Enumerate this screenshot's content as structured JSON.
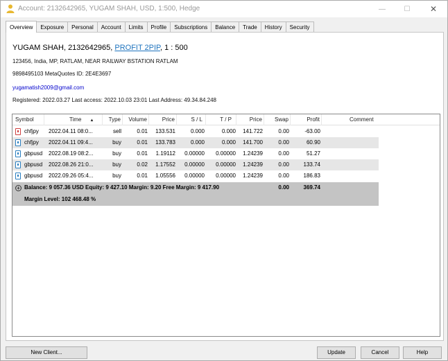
{
  "window": {
    "title": "Account: 2132642965, YUGAM SHAH, USD, 1:500, Hedge"
  },
  "tabs": [
    {
      "label": "Overview",
      "active": true
    },
    {
      "label": "Exposure"
    },
    {
      "label": "Personal"
    },
    {
      "label": "Account"
    },
    {
      "label": "Limits"
    },
    {
      "label": "Profile"
    },
    {
      "label": "Subscriptions"
    },
    {
      "label": "Balance"
    },
    {
      "label": "Trade"
    },
    {
      "label": "History"
    },
    {
      "label": "Security"
    }
  ],
  "overview": {
    "name_prefix": "YUGAM SHAH, 2132642965, ",
    "group_link": "PROFIT 2PIP",
    "leverage": ", 1 : 500",
    "address": "123456, India, MP, RATLAM, NEAR RAILWAY BSTATION RATLAM",
    "phone_line": "9898495103  MetaQuotes ID: 2E4E3697",
    "email": "yugamatish2009@gmail.com",
    "registered_line": "Registered: 2022.03.27  Last access: 2022.10.03 23:01  Last Address: 49.34.84.248"
  },
  "table": {
    "headers": {
      "symbol": "Symbol",
      "time": "Time",
      "type": "Type",
      "volume": "Volume",
      "price": "Price",
      "sl": "S / L",
      "tp": "T / P",
      "price2": "Price",
      "swap": "Swap",
      "profit": "Profit",
      "comment": "Comment"
    },
    "sort_indicator": "▲",
    "rows": [
      {
        "symbol": "chfjpy",
        "time": "2022.04.11 08:0...",
        "type": "sell",
        "volume": "0.01",
        "price": "133.531",
        "sl": "0.000",
        "tp": "0.000",
        "price2": "141.722",
        "swap": "0.00",
        "profit": "-63.00",
        "comment": "",
        "icon": "sell-order-icon"
      },
      {
        "symbol": "chfjpy",
        "time": "2022.04.11 09:4...",
        "type": "buy",
        "volume": "0.01",
        "price": "133.783",
        "sl": "0.000",
        "tp": "0.000",
        "price2": "141.700",
        "swap": "0.00",
        "profit": "60.90",
        "comment": "",
        "icon": "buy-order-icon"
      },
      {
        "symbol": "gbpusd",
        "time": "2022.08.19 08:2...",
        "type": "buy",
        "volume": "0.01",
        "price": "1.19112",
        "sl": "0.00000",
        "tp": "0.00000",
        "price2": "1.24239",
        "swap": "0.00",
        "profit": "51.27",
        "comment": "",
        "icon": "buy-order-icon"
      },
      {
        "symbol": "gbpusd",
        "time": "2022.08.26 21:0...",
        "type": "buy",
        "volume": "0.02",
        "price": "1.17552",
        "sl": "0.00000",
        "tp": "0.00000",
        "price2": "1.24239",
        "swap": "0.00",
        "profit": "133.74",
        "comment": "",
        "icon": "buy-order-icon"
      },
      {
        "symbol": "gbpusd",
        "time": "2022.09.26 05:4...",
        "type": "buy",
        "volume": "0.01",
        "price": "1.05556",
        "sl": "0.00000",
        "tp": "0.00000",
        "price2": "1.24239",
        "swap": "0.00",
        "profit": "186.83",
        "comment": "",
        "icon": "buy-order-icon"
      }
    ],
    "summary": {
      "line1": "Balance: 9 057.36 USD  Equity: 9 427.10  Margin: 9.20  Free Margin: 9 417.90",
      "swap_total": "0.00",
      "profit_total": "369.74",
      "line2": "Margin Level: 102 468.48 %"
    }
  },
  "buttons": {
    "new_client": "New Client...",
    "update": "Update",
    "cancel": "Cancel",
    "help": "Help"
  }
}
